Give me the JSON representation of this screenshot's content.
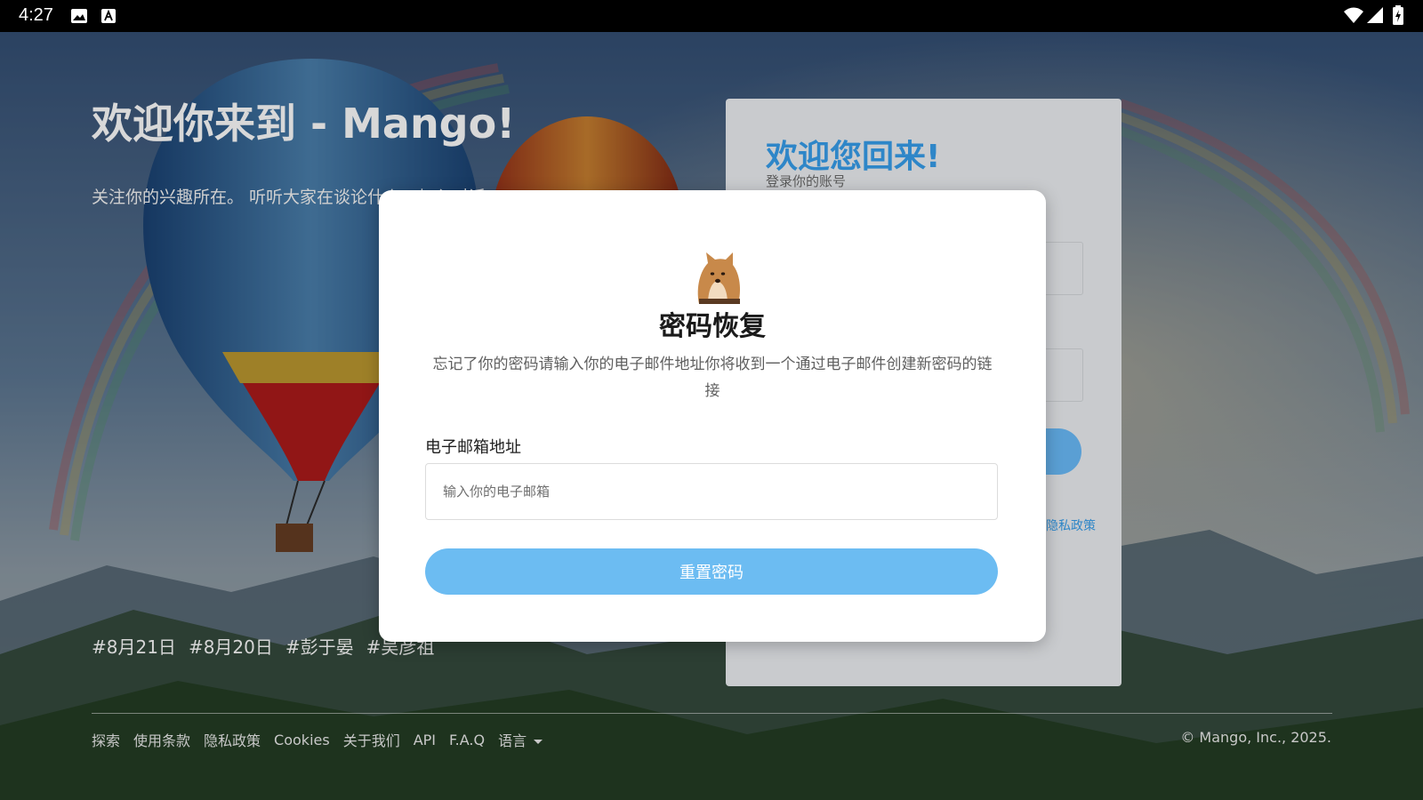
{
  "status_bar": {
    "time": "4:27"
  },
  "hero": {
    "title": "欢迎你来到 - Mango!",
    "subtitle": "关注你的兴趣所在。 听听大家在谈论什么。加入对话。",
    "tags": [
      "#8月21日",
      "#8月20日",
      "#彭于晏",
      "#吴彦祖"
    ]
  },
  "login_card": {
    "title": "欢迎您回来!",
    "subtitle": "登录你的账号",
    "policy_fragment": "隐私政策"
  },
  "modal": {
    "title": "密码恢复",
    "description": "忘记了你的密码请输入你的电子邮件地址你将收到一个通过电子邮件创建新密码的链接",
    "email_label": "电子邮箱地址",
    "email_placeholder": "输入你的电子邮箱",
    "email_value": "",
    "reset_button": "重置密码"
  },
  "footer": {
    "links": [
      "探索",
      "使用条款",
      "隐私政策",
      "Cookies",
      "关于我们",
      "API",
      "F.A.Q"
    ],
    "language": "语言",
    "copyright": "© Mango, Inc., 2025."
  },
  "colors": {
    "accent": "#2e86c8",
    "reset_button": "#6cbcf2",
    "status_bar": "#000000"
  },
  "icons": [
    "image-icon",
    "text-a-icon",
    "wifi-icon",
    "signal-icon",
    "battery-icon",
    "caret-down-icon"
  ]
}
